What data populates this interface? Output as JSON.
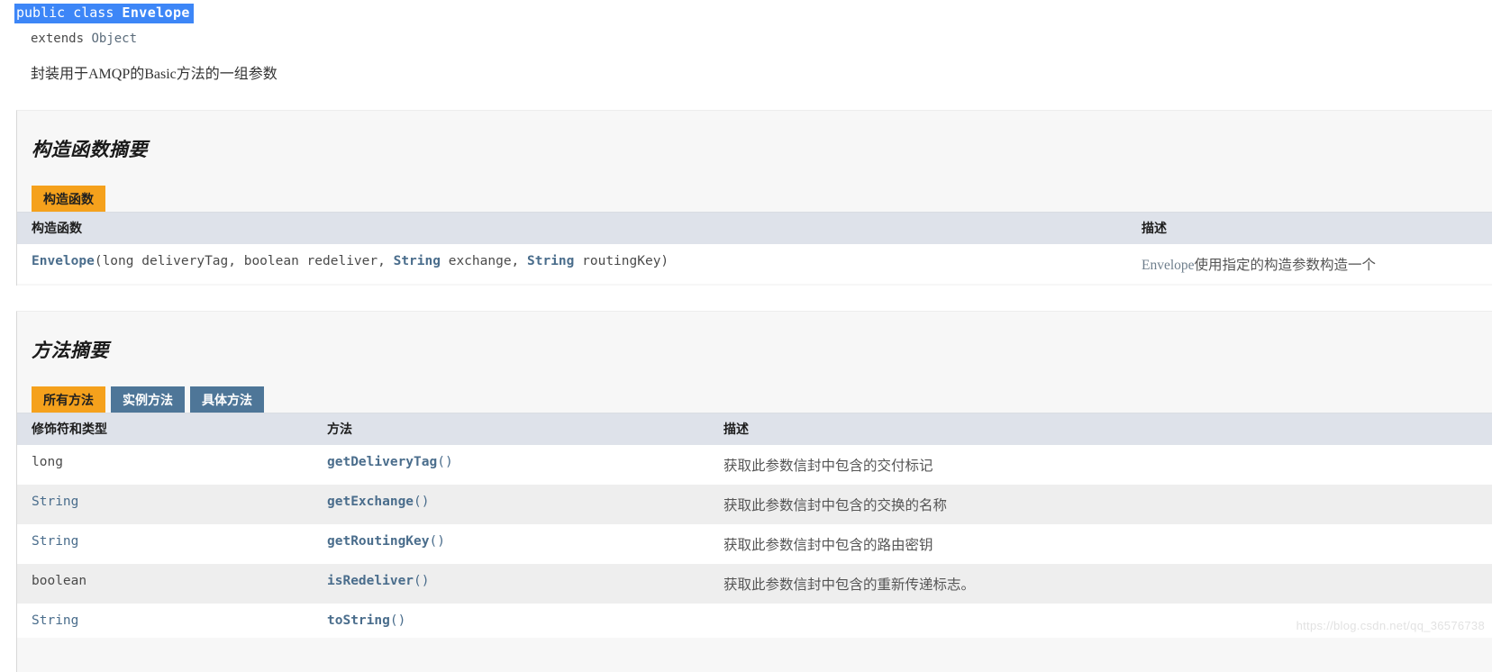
{
  "class_header": {
    "declaration_prefix": "public class ",
    "declaration_name": "Envelope",
    "extends_prefix": "extends ",
    "extends_type": "Object",
    "description": "封装用于AMQP的Basic方法的一组参数",
    "highlight_color": "#3d86f7"
  },
  "constructor_section": {
    "title": "构造函数摘要",
    "tab_label": "构造函数",
    "tab_color": "#f5a11c",
    "columns": [
      "构造函数",
      "描述"
    ],
    "rows": [
      {
        "sig_name": "Envelope",
        "sig_open": "(",
        "sig_p1_type": "long",
        "sig_p1_name": " deliveryTag, ",
        "sig_p2_type": "boolean",
        "sig_p2_name": " redeliver, ",
        "sig_p3_type": "String",
        "sig_p3_name": " exchange, ",
        "sig_p4_type": "String",
        "sig_p4_name": " routingKey)",
        "description_link": "Envelope",
        "description_rest": "使用指定的构造参数构造一个"
      }
    ]
  },
  "method_section": {
    "title": "方法摘要",
    "tabs": [
      {
        "label": "所有方法",
        "active": true
      },
      {
        "label": "实例方法",
        "active": false
      },
      {
        "label": "具体方法",
        "active": false
      }
    ],
    "columns": [
      "修饰符和类型",
      "方法",
      "描述"
    ],
    "rows": [
      {
        "type": "long",
        "type_is_link": false,
        "method": "getDeliveryTag",
        "description": "获取此参数信封中包含的交付标记"
      },
      {
        "type": "String",
        "type_is_link": true,
        "method": "getExchange",
        "description": "获取此参数信封中包含的交换的名称"
      },
      {
        "type": "String",
        "type_is_link": true,
        "method": "getRoutingKey",
        "description": "获取此参数信封中包含的路由密钥"
      },
      {
        "type": "boolean",
        "type_is_link": false,
        "method": "isRedeliver",
        "description": "获取此参数信封中包含的重新传递标志。"
      },
      {
        "type": "String",
        "type_is_link": true,
        "method": "toString",
        "description": ""
      }
    ]
  },
  "watermark": "https://blog.csdn.net/qq_36576738"
}
